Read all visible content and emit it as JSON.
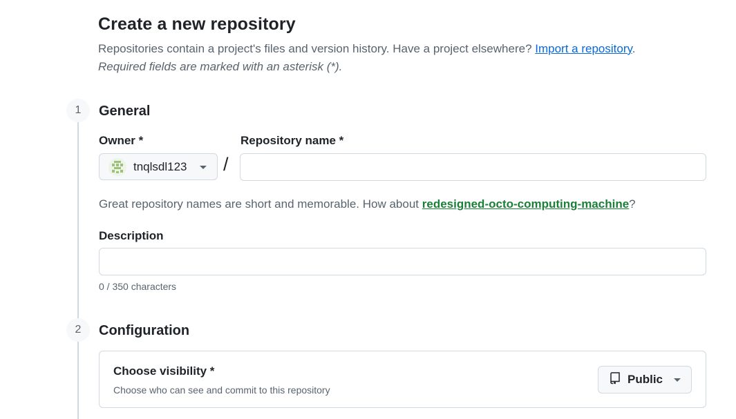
{
  "header": {
    "title": "Create a new repository",
    "intro_text": "Repositories contain a project's files and version history. Have a project elsewhere?",
    "import_link": "Import a repository",
    "intro_suffix": ".",
    "required_note": "Required fields are marked with an asterisk (*)."
  },
  "steps": {
    "general": {
      "number": "1",
      "title": "General"
    },
    "configuration": {
      "number": "2",
      "title": "Configuration"
    }
  },
  "general": {
    "owner_label": "Owner *",
    "owner_value": "tnqlsdl123",
    "separator": "/",
    "repo_name_label": "Repository name *",
    "repo_name_value": "",
    "suggestion_text": "Great repository names are short and memorable. How about",
    "suggestion_name": "redesigned-octo-computing-machine",
    "suggestion_suffix": "?",
    "description_label": "Description",
    "description_value": "",
    "char_count": "0 / 350 characters"
  },
  "configuration": {
    "visibility_title": "Choose visibility *",
    "visibility_subtitle": "Choose who can see and commit to this repository",
    "visibility_value": "Public",
    "visibility_icon": "repo-icon"
  },
  "colors": {
    "link": "#0969da",
    "suggestion": "#1a7f37",
    "muted": "#59636e",
    "border": "#d1d9e0"
  }
}
